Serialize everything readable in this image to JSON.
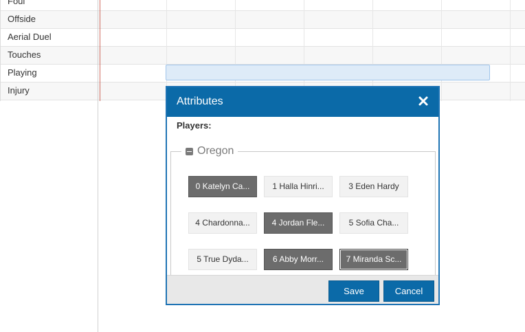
{
  "timeline": {
    "rows": [
      {
        "label": "Foul"
      },
      {
        "label": "Offside"
      },
      {
        "label": "Aerial Duel"
      },
      {
        "label": "Touches"
      },
      {
        "label": "Playing"
      },
      {
        "label": "Injury"
      }
    ]
  },
  "dialog": {
    "title": "Attributes",
    "close_icon": "close-icon",
    "players_label": "Players:",
    "team": {
      "name": "Oregon",
      "collapse_icon": "minus-square-icon",
      "players": [
        {
          "label": "0 Katelyn Ca...",
          "selected": true
        },
        {
          "label": "1 Halla Hinri...",
          "selected": false
        },
        {
          "label": "3 Eden Hardy",
          "selected": false
        },
        {
          "label": "4 Chardonna...",
          "selected": false
        },
        {
          "label": "4 Jordan Fle...",
          "selected": true
        },
        {
          "label": "5 Sofia Cha...",
          "selected": false
        },
        {
          "label": "5 True Dyda...",
          "selected": false
        },
        {
          "label": "6 Abby Morr...",
          "selected": true
        },
        {
          "label": "7 Miranda Sc...",
          "selected": true
        }
      ]
    },
    "footer": {
      "save_label": "Save",
      "cancel_label": "Cancel"
    }
  },
  "colors": {
    "header": "#0b6aa8",
    "selected_player": "#6c6c6c",
    "playing_bar": "#deebf8"
  }
}
